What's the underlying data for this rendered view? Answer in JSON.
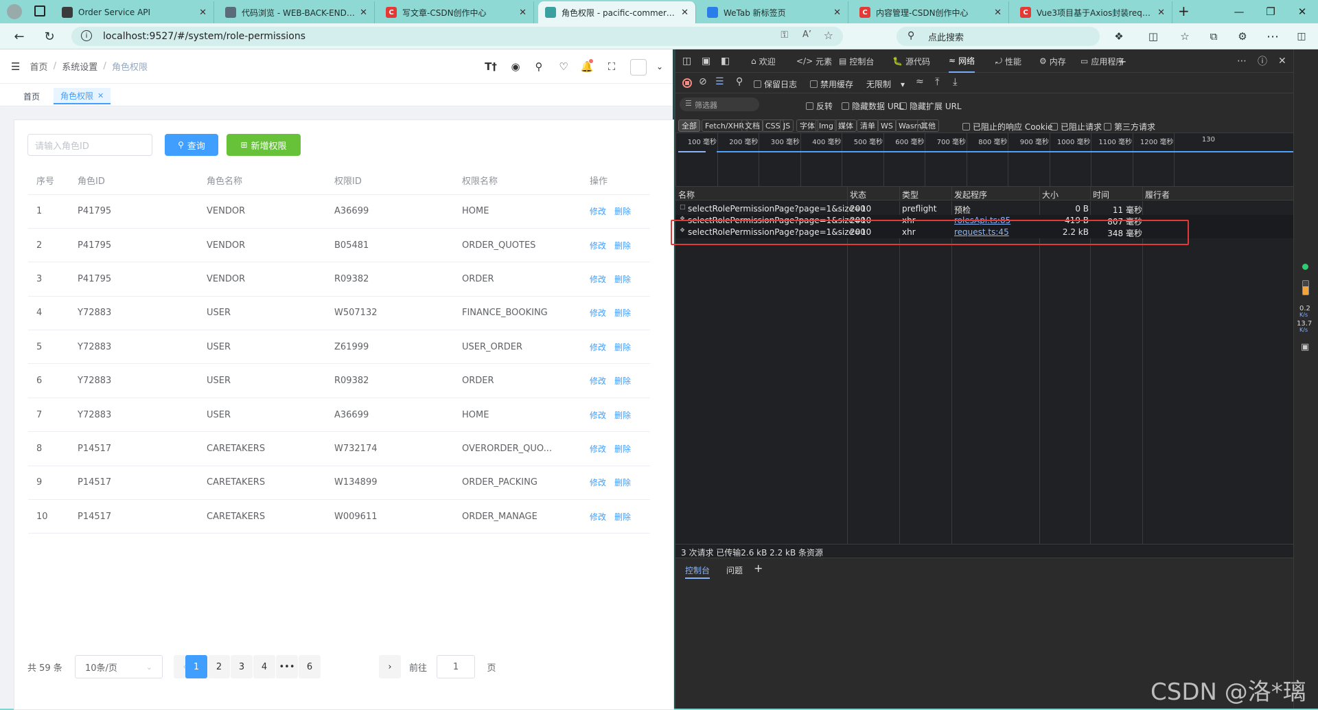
{
  "browser": {
    "tabs": [
      {
        "title": "Order Service API",
        "icon_color": "#3b3b3b",
        "icon": "doc-icon"
      },
      {
        "title": "代码浏览 - WEB-BACK-END - W",
        "icon_color": "#5a6b7a",
        "icon": "globe-icon"
      },
      {
        "title": "写文章-CSDN创作中心",
        "icon_color": "#e53935",
        "icon": "csdn-icon",
        "icon_text": "C"
      },
      {
        "title": "角色权限 - pacific-commercial-u",
        "icon_color": "#3aa0a0",
        "icon": "leaf-icon",
        "active": true
      },
      {
        "title": "WeTab 新标签页",
        "icon_color": "#2b7de9",
        "icon": "wetab-icon"
      },
      {
        "title": "内容管理-CSDN创作中心",
        "icon_color": "#e53935",
        "icon": "csdn-icon",
        "icon_text": "C"
      },
      {
        "title": "Vue3项目基于Axios封装request",
        "icon_color": "#e53935",
        "icon": "csdn-icon",
        "icon_text": "C"
      }
    ],
    "new_tab": "+",
    "url": "localhost:9527/#/system/role-permissions",
    "search_placeholder": "点此搜索"
  },
  "app": {
    "breadcrumb": [
      "首页",
      "系统设置",
      "角色权限"
    ],
    "breadcrumb_sep": "/",
    "tags": [
      {
        "label": "首页"
      },
      {
        "label": "角色权限",
        "active": true
      }
    ],
    "search": {
      "placeholder": "请输入角色ID"
    },
    "query_btn": "查询",
    "add_btn": "新增权限",
    "columns": [
      "序号",
      "角色ID",
      "角色名称",
      "权限ID",
      "权限名称",
      "操作"
    ],
    "rows": [
      [
        "1",
        "P41795",
        "VENDOR",
        "A36699",
        "HOME"
      ],
      [
        "2",
        "P41795",
        "VENDOR",
        "B05481",
        "ORDER_QUOTES"
      ],
      [
        "3",
        "P41795",
        "VENDOR",
        "R09382",
        "ORDER"
      ],
      [
        "4",
        "Y72883",
        "USER",
        "W507132",
        "FINANCE_BOOKING"
      ],
      [
        "5",
        "Y72883",
        "USER",
        "Z61999",
        "USER_ORDER"
      ],
      [
        "6",
        "Y72883",
        "USER",
        "R09382",
        "ORDER"
      ],
      [
        "7",
        "Y72883",
        "USER",
        "A36699",
        "HOME"
      ],
      [
        "8",
        "P14517",
        "CARETAKERS",
        "W732174",
        "OVERORDER_QUO..."
      ],
      [
        "9",
        "P14517",
        "CARETAKERS",
        "W134899",
        "ORDER_PACKING"
      ],
      [
        "10",
        "P14517",
        "CARETAKERS",
        "W009611",
        "ORDER_MANAGE"
      ]
    ],
    "edit_label": "修改",
    "delete_label": "删除",
    "pagination": {
      "total": "共 59 条",
      "page_size": "10条/页",
      "pages": [
        "1",
        "2",
        "3",
        "4",
        "•••",
        "6"
      ],
      "current": "1",
      "goto_label": "前往",
      "goto_value": "1",
      "page_label": "页"
    }
  },
  "devtools": {
    "tabs": [
      "欢迎",
      "元素",
      "控制台",
      "源代码",
      "网络",
      "性能",
      "内存",
      "应用程序"
    ],
    "active_tab": "网络",
    "toolbar": {
      "preserve_log": "保留日志",
      "disable_cache": "禁用缓存",
      "throttle": "无限制"
    },
    "filter_placeholder": "筛选器",
    "filter_opts": [
      "反转",
      "隐藏数据 URL",
      "隐藏扩展 URL"
    ],
    "types": [
      "全部",
      "Fetch/XHR",
      "文档",
      "CSS",
      "JS",
      "字体",
      "Img",
      "媒体",
      "清单",
      "WS",
      "Wasm",
      "其他"
    ],
    "extra_filters": [
      "已阻止的响应 Cookie",
      "已阻止请求",
      "第三方请求"
    ],
    "timeline_ticks": [
      "100 毫秒",
      "200 毫秒",
      "300 毫秒",
      "400 毫秒",
      "500 毫秒",
      "600 毫秒",
      "700 毫秒",
      "800 毫秒",
      "900 毫秒",
      "1000 毫秒",
      "1100 毫秒",
      "1200 毫秒",
      "130"
    ],
    "columns": [
      "名称",
      "状态",
      "类型",
      "发起程序",
      "大小",
      "时间",
      "履行者"
    ],
    "requests": [
      {
        "name": "selectRolePermissionPage?page=1&size=10",
        "status": "200",
        "type": "preflight",
        "initiator": "预检",
        "size": "0 B",
        "time": "11 毫秒"
      },
      {
        "name": "selectRolePermissionPage?page=1&size=10",
        "status": "200",
        "type": "xhr",
        "initiator": "rolesApi.ts:85",
        "size": "419 B",
        "time": "807 毫秒"
      },
      {
        "name": "selectRolePermissionPage?page=1&size=10",
        "status": "200",
        "type": "xhr",
        "initiator": "request.ts:45",
        "size": "2.2 kB",
        "time": "348 毫秒"
      }
    ],
    "status_bar": "3 次请求  已传输2.6 kB  2.2 kB 条资源",
    "drawer_tabs": [
      "控制台",
      "问题"
    ],
    "net_speed": [
      "0.2",
      "K/s",
      "13.7",
      "K/s"
    ]
  },
  "watermark": "CSDN @洛*璃",
  "colors": {
    "primary": "#409eff",
    "success": "#67c23a",
    "highlight": "#e53935"
  }
}
